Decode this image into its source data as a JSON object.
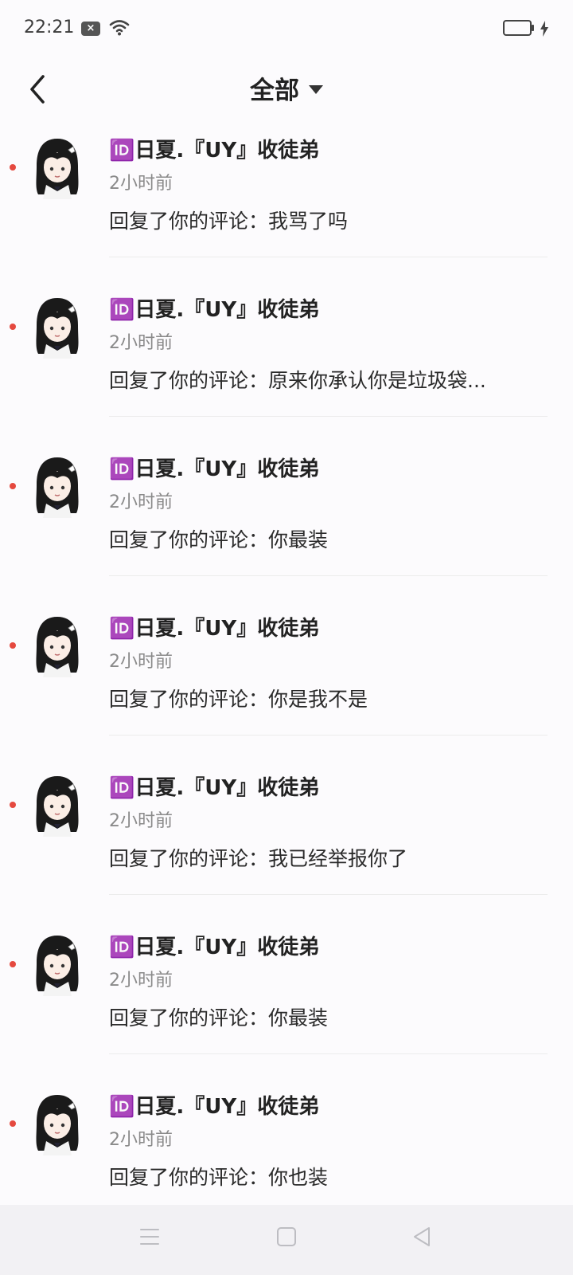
{
  "status_bar": {
    "time": "22:21",
    "notif_icon": "x-badge-icon"
  },
  "nav": {
    "title": "全部",
    "back_icon": "chevron-left-icon",
    "dropdown_icon": "triangle-down-icon"
  },
  "items": [
    {
      "username": "🆔日夏.『UY』收徒弟",
      "time": "2小时前",
      "message": "回复了你的评论：我骂了吗",
      "unread": true
    },
    {
      "username": "🆔日夏.『UY』收徒弟",
      "time": "2小时前",
      "message": "回复了你的评论：原来你承认你是垃圾袋...",
      "unread": true
    },
    {
      "username": "🆔日夏.『UY』收徒弟",
      "time": "2小时前",
      "message": "回复了你的评论：你最装",
      "unread": true
    },
    {
      "username": "🆔日夏.『UY』收徒弟",
      "time": "2小时前",
      "message": "回复了你的评论：你是我不是",
      "unread": true
    },
    {
      "username": "🆔日夏.『UY』收徒弟",
      "time": "2小时前",
      "message": "回复了你的评论：我已经举报你了",
      "unread": true
    },
    {
      "username": "🆔日夏.『UY』收徒弟",
      "time": "2小时前",
      "message": "回复了你的评论：你最装",
      "unread": true
    },
    {
      "username": "🆔日夏.『UY』收徒弟",
      "time": "2小时前",
      "message": "回复了你的评论：你也装",
      "unread": true
    }
  ],
  "colors": {
    "unread_dot": "#e5493f",
    "background": "#fcfbfd",
    "nav_bar": "#f2f1f4"
  }
}
